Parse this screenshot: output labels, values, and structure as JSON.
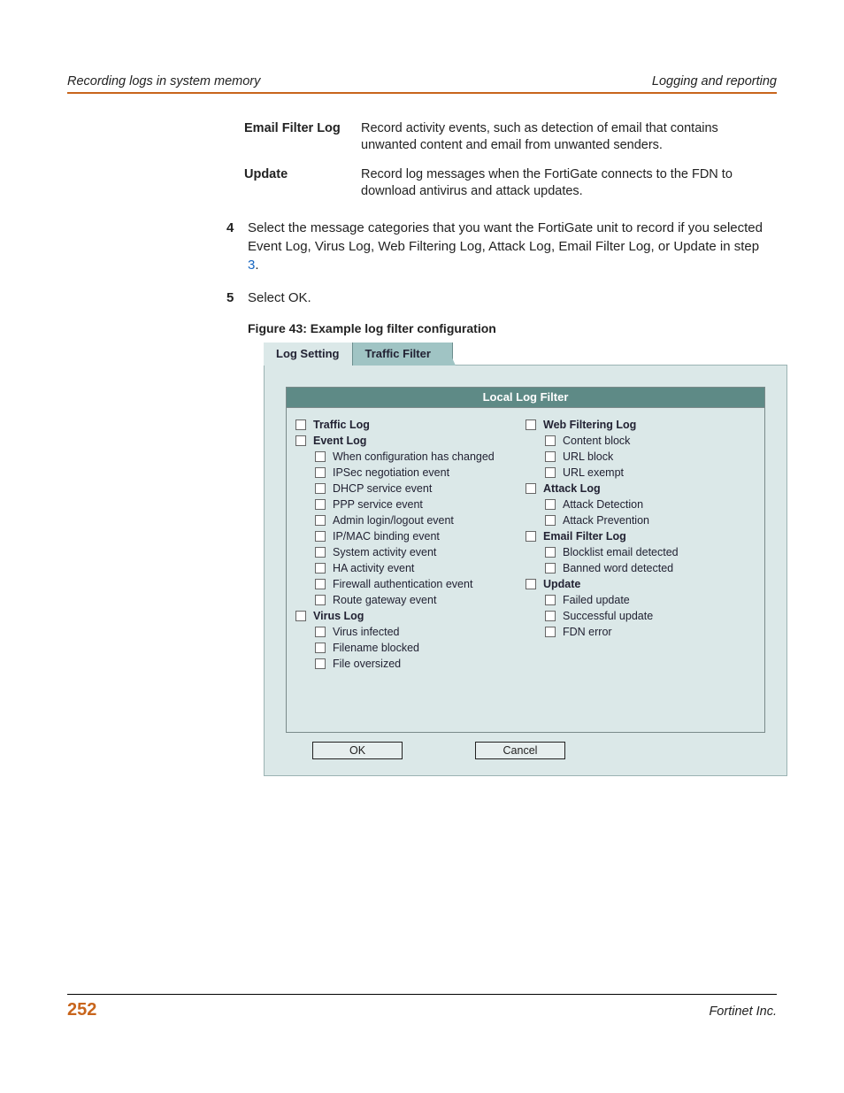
{
  "header": {
    "left": "Recording logs in system memory",
    "right": "Logging and reporting"
  },
  "defs": [
    {
      "term": "Email Filter Log",
      "desc": "Record activity events, such as detection of email that contains unwanted content and email from unwanted senders."
    },
    {
      "term": "Update",
      "desc": "Record log messages when the FortiGate connects to the FDN to download antivirus and attack updates."
    }
  ],
  "steps": {
    "four": {
      "num": "4",
      "pre": "Select the message categories that you want the FortiGate unit to record if you selected Event Log, Virus Log, Web Filtering Log, Attack Log, Email Filter Log, or Update in step ",
      "link": "3",
      "post": "."
    },
    "five": {
      "num": "5",
      "text": "Select OK."
    }
  },
  "figcap": "Figure 43: Example log filter configuration",
  "tabs": {
    "inactive": "Log Setting",
    "active": "Traffic Filter"
  },
  "panel": {
    "title": "Local Log Filter",
    "left": [
      {
        "label": "Traffic Log",
        "bold": true
      },
      {
        "label": "Event Log",
        "bold": true
      },
      {
        "label": "When configuration has changed",
        "sub": true
      },
      {
        "label": "IPSec negotiation event",
        "sub": true
      },
      {
        "label": "DHCP service event",
        "sub": true
      },
      {
        "label": "PPP service event",
        "sub": true
      },
      {
        "label": "Admin login/logout event",
        "sub": true
      },
      {
        "label": "IP/MAC binding event",
        "sub": true
      },
      {
        "label": "System activity event",
        "sub": true
      },
      {
        "label": "HA activity event",
        "sub": true
      },
      {
        "label": "Firewall authentication event",
        "sub": true
      },
      {
        "label": "Route gateway event",
        "sub": true
      },
      {
        "label": "Virus Log",
        "bold": true
      },
      {
        "label": "Virus infected",
        "sub": true
      },
      {
        "label": "Filename blocked",
        "sub": true
      },
      {
        "label": "File oversized",
        "sub": true
      }
    ],
    "right": [
      {
        "label": "Web Filtering Log",
        "bold": true
      },
      {
        "label": "Content block",
        "sub": true
      },
      {
        "label": "URL block",
        "sub": true
      },
      {
        "label": "URL exempt",
        "sub": true
      },
      {
        "label": "Attack Log",
        "bold": true
      },
      {
        "label": "Attack Detection",
        "sub": true
      },
      {
        "label": "Attack Prevention",
        "sub": true
      },
      {
        "label": "Email Filter Log",
        "bold": true
      },
      {
        "label": "Blocklist email detected",
        "sub": true
      },
      {
        "label": "Banned word detected",
        "sub": true
      },
      {
        "label": "Update",
        "bold": true
      },
      {
        "label": "Failed update",
        "sub": true
      },
      {
        "label": "Successful update",
        "sub": true
      },
      {
        "label": "FDN error",
        "sub": true
      }
    ],
    "buttons": {
      "ok": "OK",
      "cancel": "Cancel"
    }
  },
  "footer": {
    "page": "252",
    "right": "Fortinet Inc."
  }
}
